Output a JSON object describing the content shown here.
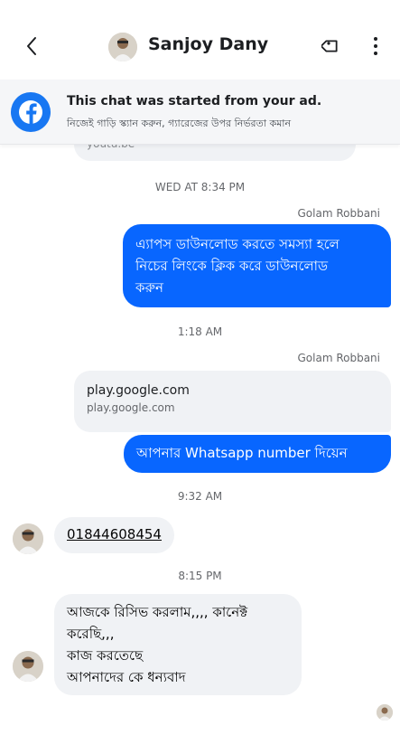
{
  "header": {
    "contact_name": "Sanjoy Dany"
  },
  "ad_banner": {
    "title": "This chat was started from your ad.",
    "subtitle": "নিজেই গাড়ি স্ক্যান করুন, গ্যারেজের উপর নির্ভরতা কমান"
  },
  "chat": {
    "cut_preview_text": "youtu.be",
    "messages": [
      {
        "type": "timestamp",
        "text": "WED AT 8:34 PM"
      },
      {
        "type": "sender",
        "text": "Golam Robbani"
      },
      {
        "type": "outgoing",
        "lines": [
          "এ্যাপস ডাউনলোড করতে সমস্যা হলে",
          "নিচের লিংকে ক্লিক করে ডাউনলোড",
          "করুন"
        ]
      },
      {
        "type": "timestamp",
        "text": "1:18 AM"
      },
      {
        "type": "sender",
        "text": "Golam Robbani"
      },
      {
        "type": "link_card",
        "title": "play.google.com",
        "domain": "play.google.com"
      },
      {
        "type": "outgoing",
        "text": "আপনার Whatsapp number দিয়েন"
      },
      {
        "type": "timestamp",
        "text": "9:32 AM"
      },
      {
        "type": "incoming",
        "text": "01844608454"
      },
      {
        "type": "timestamp",
        "text": "8:15 PM"
      },
      {
        "type": "incoming",
        "lines": [
          "আজকে রিসিভ করলাম,,,, কানেক্ট",
          "করেছি,,,",
          "কাজ করতেছে",
          "আপনাদের কে ধন্যবাদ"
        ]
      }
    ]
  },
  "colors": {
    "outgoing_bubble": "#0866ff",
    "incoming_bubble": "#f0f2f5",
    "facebook_blue": "#1877f2"
  },
  "icons": [
    "back-arrow-icon",
    "tag-icon",
    "more-options-icon",
    "facebook-logo-icon"
  ]
}
